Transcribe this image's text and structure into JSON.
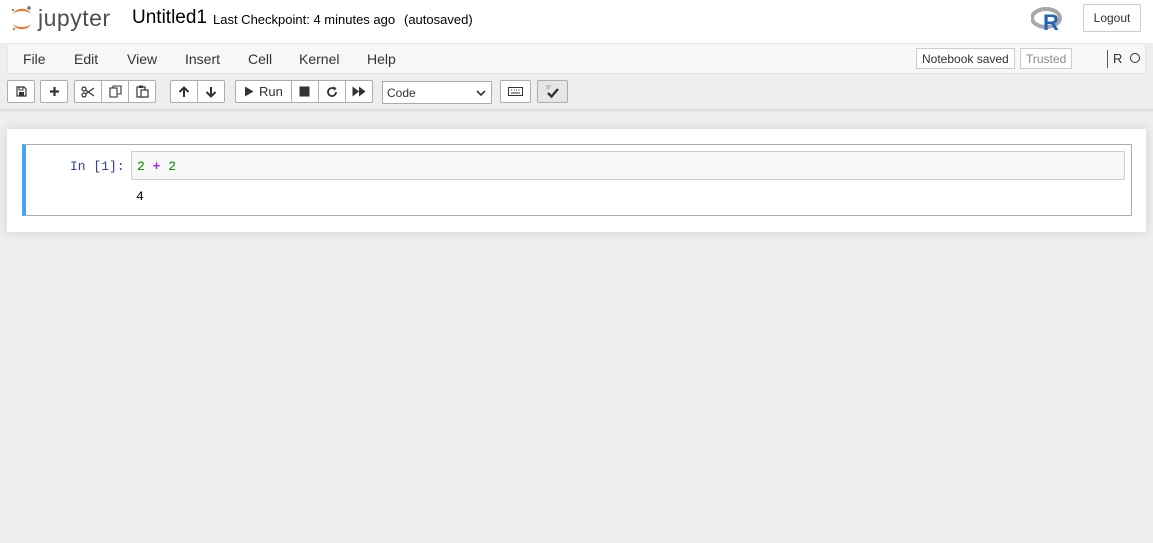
{
  "header": {
    "logo_text": "jupyter",
    "notebook_name": "Untitled1",
    "checkpoint": "Last Checkpoint: 4 minutes ago",
    "autosave_status": "(autosaved)",
    "logout_label": "Logout"
  },
  "menu": {
    "items": [
      "File",
      "Edit",
      "View",
      "Insert",
      "Cell",
      "Kernel",
      "Help"
    ],
    "notebook_saved": "Notebook saved",
    "trusted": "Trusted",
    "kernel_name": "R"
  },
  "toolbar": {
    "run_label": "Run",
    "cell_type": "Code",
    "icons": [
      "save-icon",
      "plus-icon",
      "cut-icon",
      "copy-icon",
      "paste-icon",
      "arrow-up-icon",
      "arrow-down-icon",
      "play-icon",
      "stop-icon",
      "restart-icon",
      "fast-forward-icon",
      "keyboard-icon",
      "celltoolbar-check-icon"
    ]
  },
  "cell": {
    "prompt": "In [1]:",
    "code_left": "2",
    "code_op": "+",
    "code_right": "2",
    "output": "4"
  },
  "colors": {
    "jupyter_orange": "#f37726",
    "prompt_blue": "#303f9f",
    "selected_cell_border": "#42a5f5",
    "code_number": "#008800",
    "code_operator": "#aa22ff"
  }
}
